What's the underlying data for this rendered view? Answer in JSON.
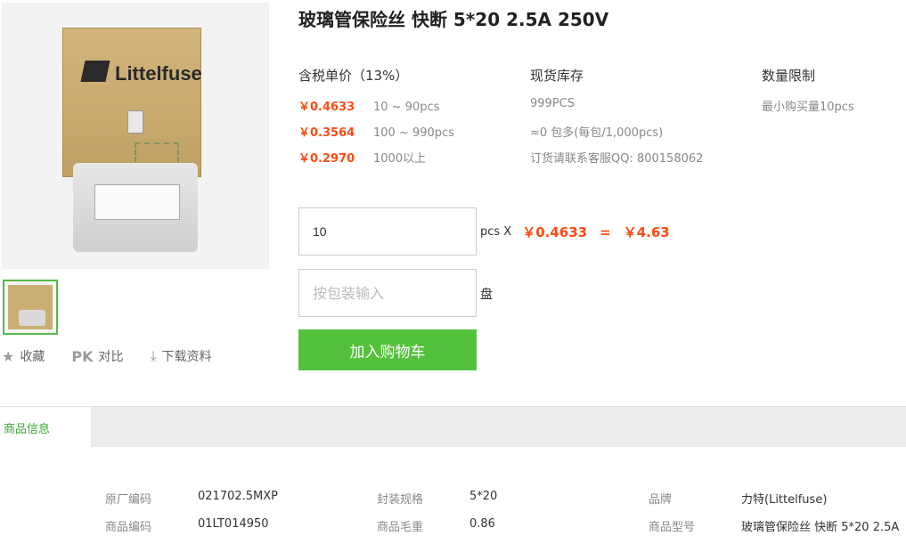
{
  "product": {
    "title": "玻璃管保险丝 快断 5*20 2.5A 250V",
    "image_brand_text": "Littelfuse"
  },
  "actions": [
    {
      "icon": "star-icon",
      "label": "收藏"
    },
    {
      "icon": "compare-icon",
      "badge": "PK",
      "label": "对比"
    },
    {
      "icon": "download-icon",
      "label": "下载资料"
    }
  ],
  "pricing": {
    "header": "含税单价（13%）",
    "tiers": [
      {
        "price": "￥0.4633",
        "range": "10 ~ 90pcs"
      },
      {
        "price": "￥0.3564",
        "range": "100 ~ 990pcs"
      },
      {
        "price": "￥0.2970",
        "range": "1000以上"
      }
    ]
  },
  "stock": {
    "header": "现货库存",
    "lines": [
      "999PCS",
      "≈0 包多(每包/1,000pcs)",
      "订货请联系客服QQ: 800158062"
    ]
  },
  "limit": {
    "header": "数量限制",
    "lines": [
      "最小购买量10pcs"
    ]
  },
  "order": {
    "quantity": "10",
    "unit": "pcs X",
    "unit_price": "￥0.4633",
    "equals": "=",
    "total": "￥4.63",
    "pack_placeholder": "按包装输入",
    "pack_unit": "盘",
    "add_to_cart": "加入购物车"
  },
  "tabs": [
    {
      "label": "商品信息"
    }
  ],
  "specs": [
    {
      "label": "原厂编码",
      "value": "021702.5MXP"
    },
    {
      "label": "封装规格",
      "value": "5*20"
    },
    {
      "label": "品牌",
      "value": "力特(Littelfuse)"
    },
    {
      "label": "商品编码",
      "value": "01LT014950"
    },
    {
      "label": "商品毛重",
      "value": "0.86"
    },
    {
      "label": "商品型号",
      "value": "玻璃管保险丝 快断 5*20 2.5A"
    }
  ],
  "colors": {
    "accent_green": "#53c13b",
    "price_orange": "#ff4a13"
  }
}
